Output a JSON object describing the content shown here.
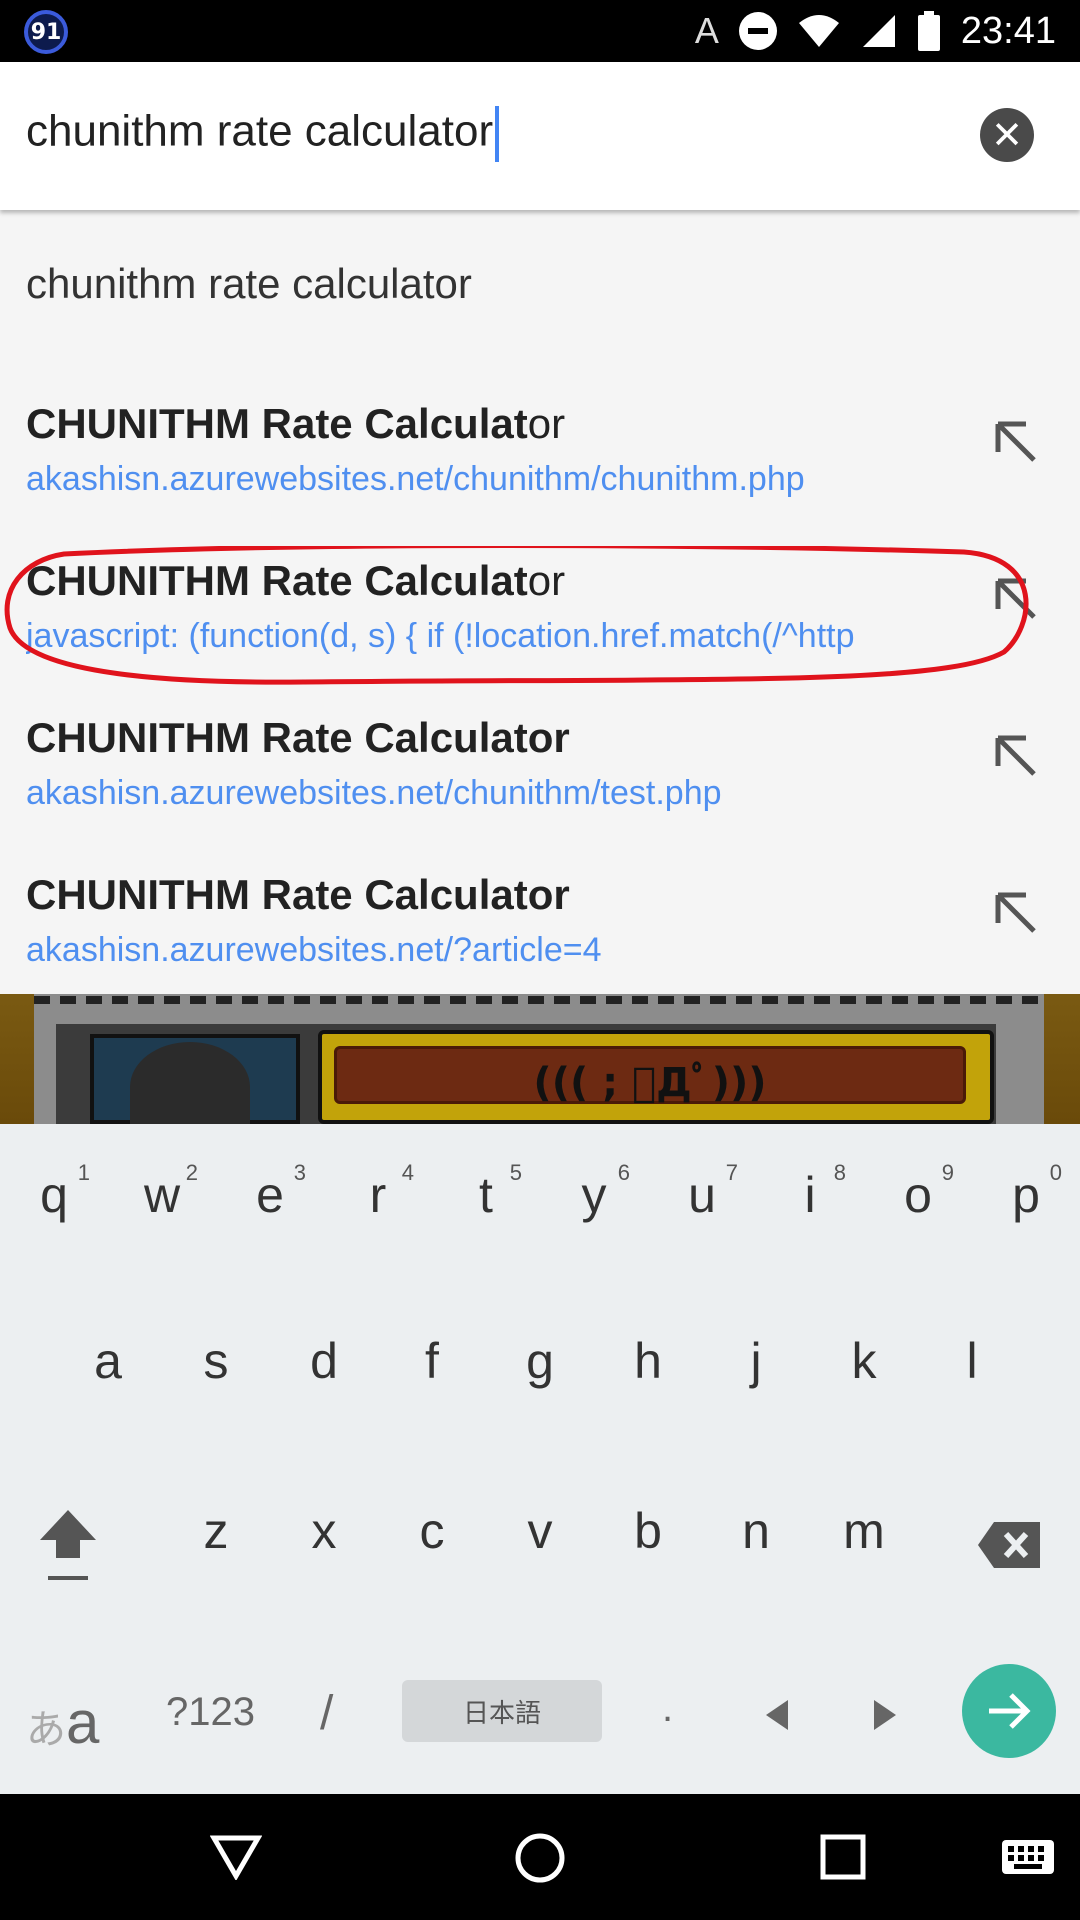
{
  "status_bar": {
    "notification_count": "91",
    "input_indicator": "A",
    "time": "23:41",
    "icons": [
      "do-not-disturb-icon",
      "wifi-icon",
      "cell-signal-icon",
      "battery-icon"
    ]
  },
  "search": {
    "query": "chunithm rate calculator",
    "clear_icon": "close-circle-icon"
  },
  "suggestions": {
    "plain": "chunithm rate calculator",
    "items": [
      {
        "title_bold": "CHUNITHM Rate Calculat",
        "title_rest": "or",
        "url": "akashisn.azurewebsites.net/chunithm/chunithm.php"
      },
      {
        "title_bold": "CHUNITHM Rate Calculat",
        "title_rest": "or",
        "url": "javascript: (function(d, s) {    if (!location.href.match(/^http"
      },
      {
        "title_bold": "CHUNITHM Rate Calculator",
        "title_rest": "",
        "url": "akashisn.azurewebsites.net/chunithm/test.php"
      },
      {
        "title_bold": "CHUNITHM Rate Calculator",
        "title_rest": "",
        "url": "akashisn.azurewebsites.net/?article=4"
      }
    ],
    "annotation_color": "#e0131c"
  },
  "background_strip": {
    "text": "((( ; ﾟДﾟ)))"
  },
  "keyboard": {
    "row1": [
      {
        "ch": "q",
        "hint": "1"
      },
      {
        "ch": "w",
        "hint": "2"
      },
      {
        "ch": "e",
        "hint": "3"
      },
      {
        "ch": "r",
        "hint": "4"
      },
      {
        "ch": "t",
        "hint": "5"
      },
      {
        "ch": "y",
        "hint": "6"
      },
      {
        "ch": "u",
        "hint": "7"
      },
      {
        "ch": "i",
        "hint": "8"
      },
      {
        "ch": "o",
        "hint": "9"
      },
      {
        "ch": "p",
        "hint": "0"
      }
    ],
    "row2": [
      "a",
      "s",
      "d",
      "f",
      "g",
      "h",
      "j",
      "k",
      "l"
    ],
    "row3": [
      "z",
      "x",
      "c",
      "v",
      "b",
      "n",
      "m"
    ],
    "row4": {
      "kana": "あ",
      "latin": "a",
      "symbols": "?123",
      "slash": "/",
      "language": "日本語",
      "period": "."
    },
    "accent": "#3bb8a0"
  },
  "nav_bar": {
    "icons": [
      "back-icon",
      "home-icon",
      "recents-icon",
      "keyboard-icon"
    ]
  }
}
